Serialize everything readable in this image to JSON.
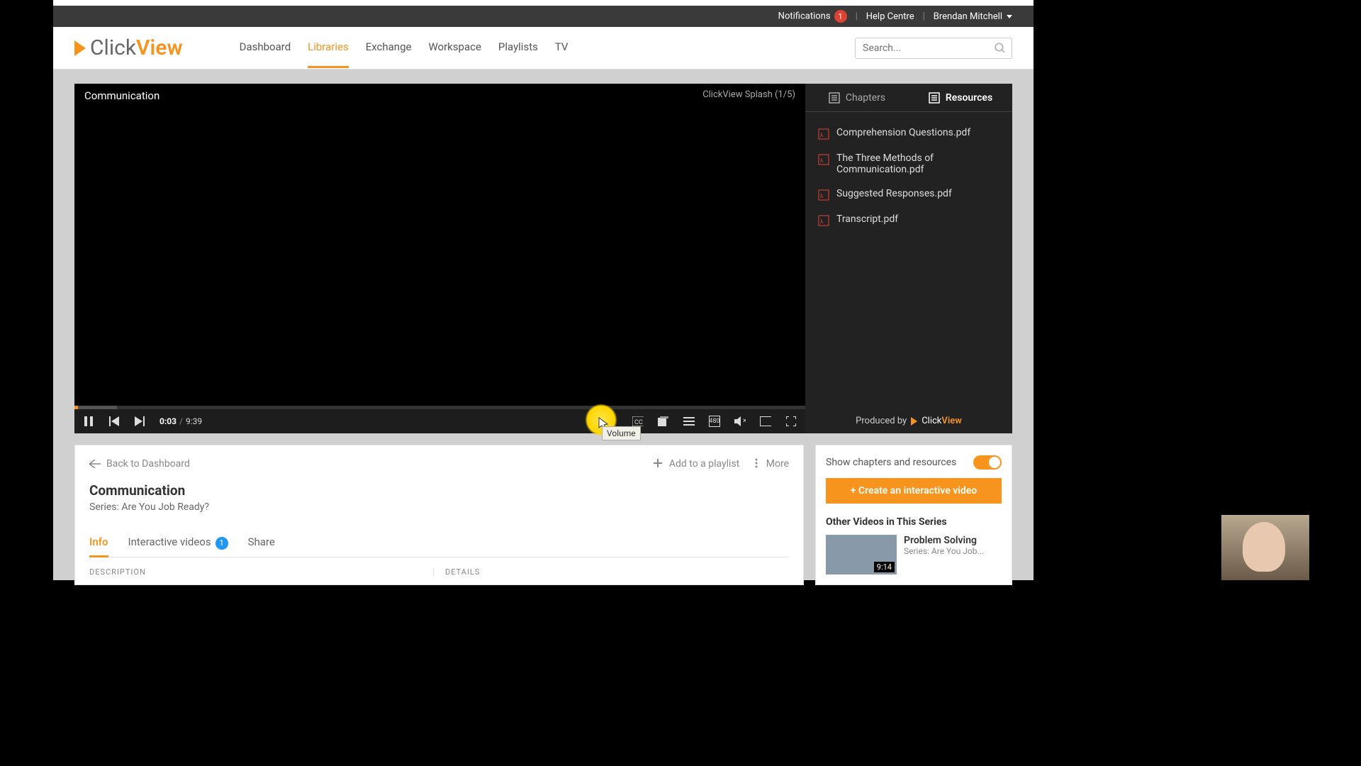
{
  "topbar": {
    "notifications": "Notifications",
    "notif_count": "1",
    "help": "Help Centre",
    "user": "Brendan Mitchell"
  },
  "logo": {
    "prefix": "Click",
    "suffix": "View"
  },
  "nav": {
    "dashboard": "Dashboard",
    "libraries": "Libraries",
    "exchange": "Exchange",
    "workspace": "Workspace",
    "playlists": "Playlists",
    "tv": "TV"
  },
  "search": {
    "placeholder": "Search..."
  },
  "player": {
    "title": "Communication",
    "splash": "ClickView Splash  (1/5)",
    "time_current": "0:03",
    "time_total": "9:39",
    "quality": "480",
    "volume_tooltip": "Volume"
  },
  "sidetabs": {
    "chapters": "Chapters",
    "resources": "Resources"
  },
  "resources": [
    "Comprehension Questions.pdf",
    "The Three Methods of Communication.pdf",
    "Suggested Responses.pdf",
    "Transcript.pdf"
  ],
  "producedby": {
    "label": "Produced by",
    "brand_prefix": "Click",
    "brand_suffix": "View"
  },
  "info": {
    "back": "Back to Dashboard",
    "add_playlist": "Add to a playlist",
    "more": "More",
    "title": "Communication",
    "series": "Series: Are You Job Ready?",
    "tab_info": "Info",
    "tab_interactive": "Interactive videos",
    "tab_interactive_count": "1",
    "tab_share": "Share",
    "description_heading": "DESCRIPTION",
    "details_heading": "DETAILS"
  },
  "rightpanel": {
    "toggle_label": "Show chapters and resources",
    "create_btn": "+ Create an interactive video",
    "other_title": "Other Videos in This Series",
    "item_title": "Problem Solving",
    "item_series": "Series: Are You Job...",
    "item_duration": "9:14"
  }
}
